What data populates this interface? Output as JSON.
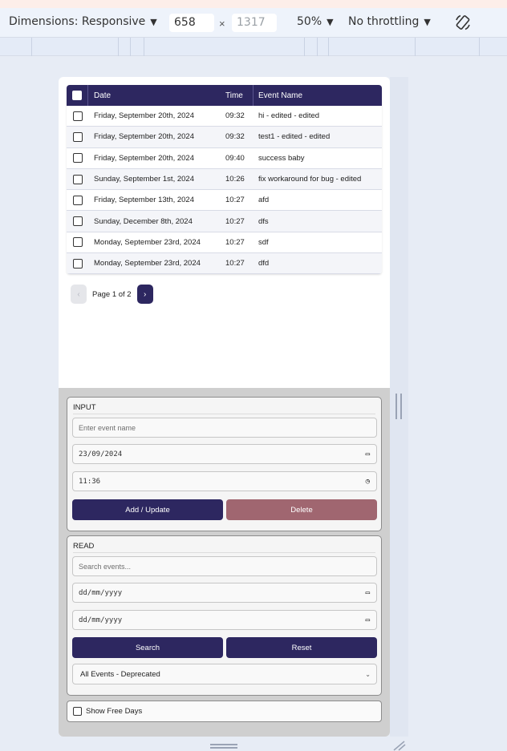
{
  "devtools": {
    "dimensions_label": "Dimensions: Responsive",
    "width_value": "658",
    "height_value": "1317",
    "times_sign": "×",
    "zoom": "50%",
    "throttling": "No throttling"
  },
  "table": {
    "headers": {
      "date": "Date",
      "time": "Time",
      "event": "Event Name"
    },
    "rows": [
      {
        "date": "Friday, September 20th, 2024",
        "time": "09:32",
        "event": "hi - edited - edited"
      },
      {
        "date": "Friday, September 20th, 2024",
        "time": "09:32",
        "event": "test1 - edited - edited"
      },
      {
        "date": "Friday, September 20th, 2024",
        "time": "09:40",
        "event": "success baby"
      },
      {
        "date": "Sunday, September 1st, 2024",
        "time": "10:26",
        "event": "fix workaround for bug - edited"
      },
      {
        "date": "Friday, September 13th, 2024",
        "time": "10:27",
        "event": "afd"
      },
      {
        "date": "Sunday, December 8th, 2024",
        "time": "10:27",
        "event": "dfs"
      },
      {
        "date": "Monday, September 23rd, 2024",
        "time": "10:27",
        "event": "sdf"
      },
      {
        "date": "Monday, September 23rd, 2024",
        "time": "10:27",
        "event": "dfd"
      }
    ]
  },
  "pagination": {
    "prev": "‹",
    "next": "›",
    "label": "Page 1 of 2"
  },
  "input_card": {
    "title": "INPUT",
    "event_name_placeholder": "Enter event name",
    "date_value": "23/09/2024",
    "time_value": "11:36",
    "add_update_label": "Add / Update",
    "delete_label": "Delete"
  },
  "read_card": {
    "title": "READ",
    "search_placeholder": "Search events...",
    "from_date_value": "dd/mm/yyyy",
    "to_date_value": "dd/mm/yyyy",
    "search_label": "Search",
    "reset_label": "Reset",
    "filter_selected": "All Events - Deprecated"
  },
  "free_days_label": "Show Free Days",
  "colors": {
    "primary": "#2d2760",
    "danger": "#a06670"
  }
}
